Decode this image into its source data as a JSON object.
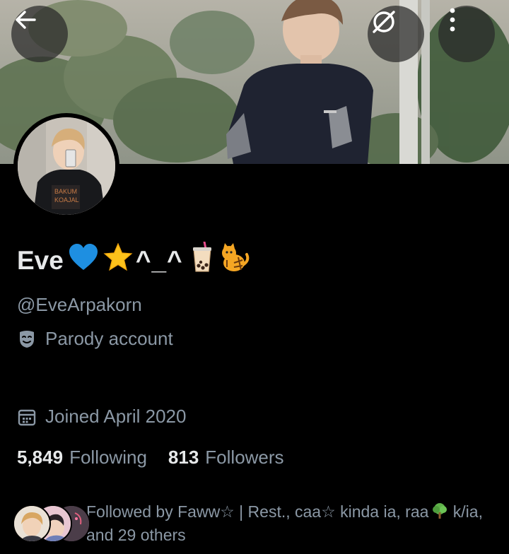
{
  "profile": {
    "display_name": "Eve",
    "display_name_caret": "^_^",
    "handle": "@EveArpakorn",
    "label": "Parody account",
    "joined": "Joined April 2020"
  },
  "stats": {
    "following_count": "5,849",
    "following_label": "Following",
    "followers_count": "813",
    "followers_label": "Followers"
  },
  "followed_by": {
    "line1": "Followed by Faww☆ | Rest., ᴄaa☆ kinda ia, raa",
    "line1_tail": " k/ia,",
    "line2": "and 29 others"
  },
  "icons": {
    "back": "arrow-left-icon",
    "no_translate": "no-translate-icon",
    "more": "more-vertical-icon",
    "parody": "theater-mask-icon",
    "calendar": "calendar-icon",
    "heart": "blue-heart-emoji",
    "star": "star-emoji",
    "bubble_tea": "bubble-tea-emoji",
    "cat": "tiger-cat-emoji",
    "tree": "tree-emoji"
  },
  "colors": {
    "background": "#000000",
    "primary_text": "#e7e9ea",
    "secondary_text": "#8b98a5",
    "overlay_button": "#282828"
  }
}
